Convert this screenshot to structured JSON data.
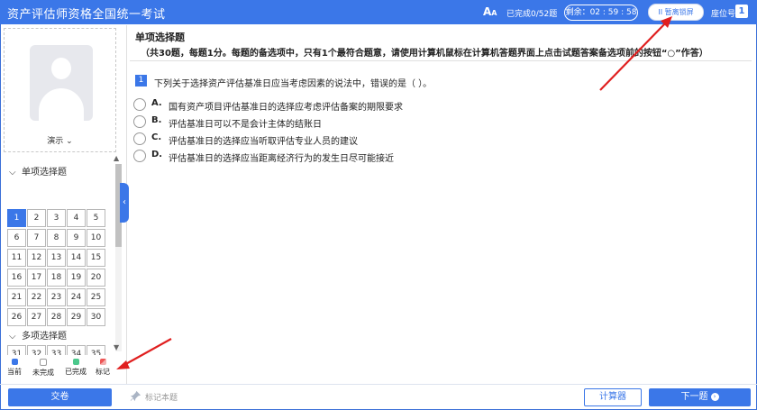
{
  "header": {
    "title": "资产评估师资格全国统一考试",
    "font_size_icon": "A",
    "font_size_icon_small": "A",
    "progress": "已完成0/52题",
    "timer": "剩余：02 : 59 : 58",
    "leave_button": "II 暂离锁屏",
    "seat_label": "座位号",
    "seat_number": "1"
  },
  "sidebar": {
    "demo_label": "演示",
    "section1_title": "单项选择题",
    "section1_numbers": [
      "1",
      "2",
      "3",
      "4",
      "5",
      "6",
      "7",
      "8",
      "9",
      "10",
      "11",
      "12",
      "13",
      "14",
      "15",
      "16",
      "17",
      "18",
      "19",
      "20",
      "21",
      "22",
      "23",
      "24",
      "25",
      "26",
      "27",
      "28",
      "29",
      "30"
    ],
    "section2_title": "多项选择题",
    "section2_numbers": [
      "31",
      "32",
      "33",
      "34",
      "35"
    ],
    "legend": [
      {
        "label": "当前",
        "color": "#3b77e8"
      },
      {
        "label": "未完成",
        "color": "#ffffff"
      },
      {
        "label": "已完成",
        "color": "#4cc88c"
      },
      {
        "label": "标记",
        "color": "#ee5555"
      }
    ]
  },
  "question": {
    "section_title": "单项选择题",
    "section_desc": "（共30题，每题1分。每题的备选项中，只有1个最符合题意，请使用计算机鼠标在计算机答题界面上点击试题答案备选项前的按钮“○”作答）",
    "number": "1",
    "text": "下列关于选择资产评估基准日应当考虑因素的说法中，错误的是（        ）。",
    "options": [
      {
        "letter": "A.",
        "text": "国有资产项目评估基准日的选择应考虑评估备案的期限要求"
      },
      {
        "letter": "B.",
        "text": "评估基准日可以不是会计主体的结账日"
      },
      {
        "letter": "C.",
        "text": "评估基准日的选择应当听取评估专业人员的建议"
      },
      {
        "letter": "D.",
        "text": "评估基准日的选择应当距离经济行为的发生日尽可能接近"
      }
    ]
  },
  "footer": {
    "submit": "交卷",
    "mark": "标记本题",
    "calculator": "计算器",
    "next": "下一题",
    "next_icon": "›"
  },
  "colors": {
    "accent": "#3b77e8",
    "annotation_arrow": "#e01f1f"
  }
}
